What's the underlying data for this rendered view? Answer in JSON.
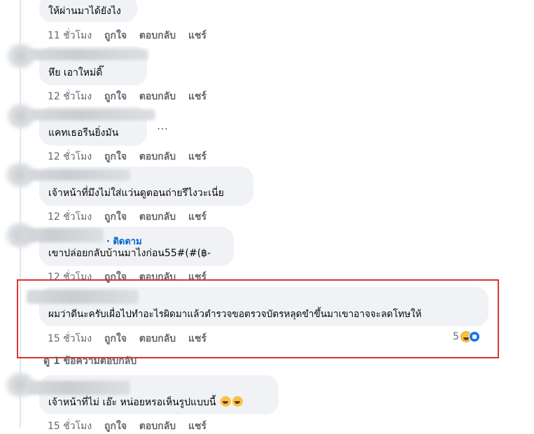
{
  "comments": [
    {
      "text_lines": [
        "ให้ผ่านมาได้ยังไง"
      ],
      "time": "11 ชั่วโมง",
      "like": "ถูกใจ",
      "reply": "ตอบกลับ",
      "share": "แชร์"
    },
    {
      "text_lines": [
        "หึย เอาใหม่ดิ๊"
      ],
      "time": "12 ชั่วโมง",
      "like": "ถูกใจ",
      "reply": "ตอบกลับ",
      "share": "แชร์"
    },
    {
      "text_lines": [
        "แคทเธอรีนยิ่งมัน"
      ],
      "time": "12 ชั่วโมง",
      "like": "ถูกใจ",
      "reply": "ตอบกลับ",
      "share": "แชร์",
      "more": "…"
    },
    {
      "text_lines": [
        "เจ้าหน้าที่มึงไม่ใส่แว่นดูตอนถ่ายรึไงวะเนี่ย"
      ],
      "time": "12 ชั่วโมง",
      "like": "ถูกใจ",
      "reply": "ตอบกลับ",
      "share": "แชร์"
    },
    {
      "follow": "· ติดตาม",
      "text_lines": [
        "เขาปล่อยกลับบ้านมาไงก่อน55#(#(฿-"
      ],
      "time": "12 ชั่วโมง",
      "like": "ถูกใจ",
      "reply": "ตอบกลับ",
      "share": "แชร์"
    },
    {
      "text_lines": [
        "ผมว่าดีนะครับเผื่อไปทำอะไรผิดมาแล้วตำรวจขอตรวจบัตรหลุดขำขึ้นมาเขาอาจจะลดโทษให้"
      ],
      "time": "15 ชั่วโมง",
      "like": "ถูกใจ",
      "reply": "ตอบกลับ",
      "share": "แชร์",
      "reaction_count": "5",
      "reactions": [
        "haha-emoji",
        "like-emoji"
      ]
    },
    {
      "text_lines": [
        "เจ้าหน้าที่ไม่ เอ๊ะ หน่อยหรอเห็นรูปแบบนี้"
      ],
      "time": "15 ชั่วโมง",
      "like": "ถูกใจ",
      "reply": "ตอบกลับ",
      "share": "แชร์",
      "trailing_emojis": [
        "rofl-emoji",
        "rofl-emoji"
      ]
    }
  ],
  "view_replies": "ดู 1 ข้อความตอบกลับ",
  "highlight_color": "#d93434",
  "link_color": "#0064d1"
}
